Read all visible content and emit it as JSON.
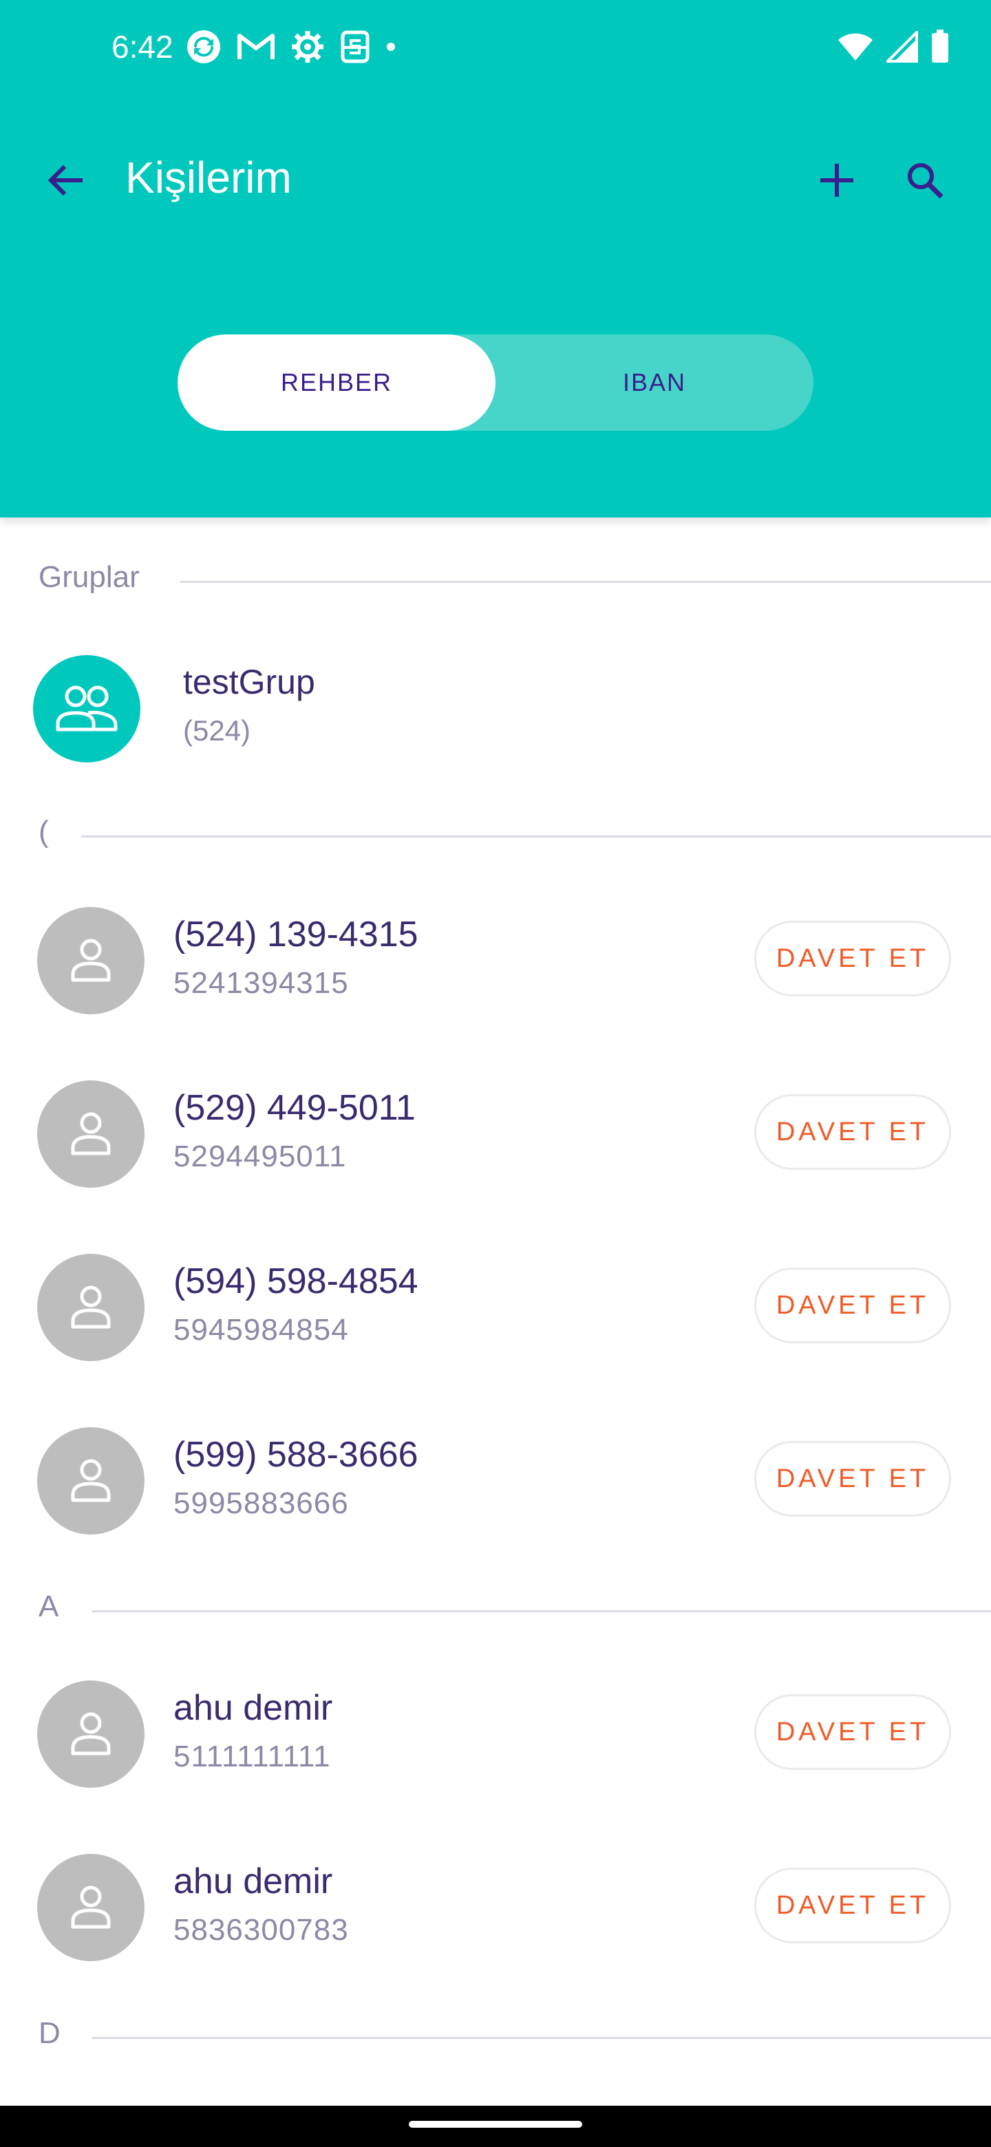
{
  "status_bar": {
    "time": "6:42",
    "left_icons": [
      "sync-icon",
      "gmail-icon",
      "settings-icon",
      "s-icon",
      "dot-icon"
    ],
    "right_icons": [
      "wifi-icon",
      "signal-icon",
      "battery-icon"
    ]
  },
  "toolbar": {
    "title": "Kişilerim",
    "back_icon": "arrow-left-icon",
    "add_icon": "plus-icon",
    "search_icon": "search-icon"
  },
  "tabs": [
    {
      "label": "REHBER",
      "active": true
    },
    {
      "label": "IBAN",
      "active": false
    }
  ],
  "sections": {
    "groups": "Gruplar",
    "paren": "(",
    "a": "A",
    "d": "D"
  },
  "group": {
    "name": "testGrup",
    "count": "(524)"
  },
  "contacts": [
    {
      "name": "(524) 139-4315",
      "phone": "5241394315",
      "action": "DAVET ET"
    },
    {
      "name": "(529) 449-5011",
      "phone": "5294495011",
      "action": "DAVET ET"
    },
    {
      "name": "(594) 598-4854",
      "phone": "5945984854",
      "action": "DAVET ET"
    },
    {
      "name": "(599) 588-3666",
      "phone": "5995883666",
      "action": "DAVET ET"
    },
    {
      "name": "ahu demir",
      "phone": "5111111111",
      "action": "DAVET ET"
    },
    {
      "name": "ahu demir",
      "phone": "5836300783",
      "action": "DAVET ET"
    }
  ],
  "colors": {
    "header_bg": "#00C8BC",
    "segment_inactive": "#48D5C9",
    "primary_text": "#3A2A6E",
    "secondary_text": "#8F88A6",
    "accent_action": "#F05A28",
    "icon_purple": "#3A1E8E",
    "avatar_grey": "#BDBDBD"
  }
}
